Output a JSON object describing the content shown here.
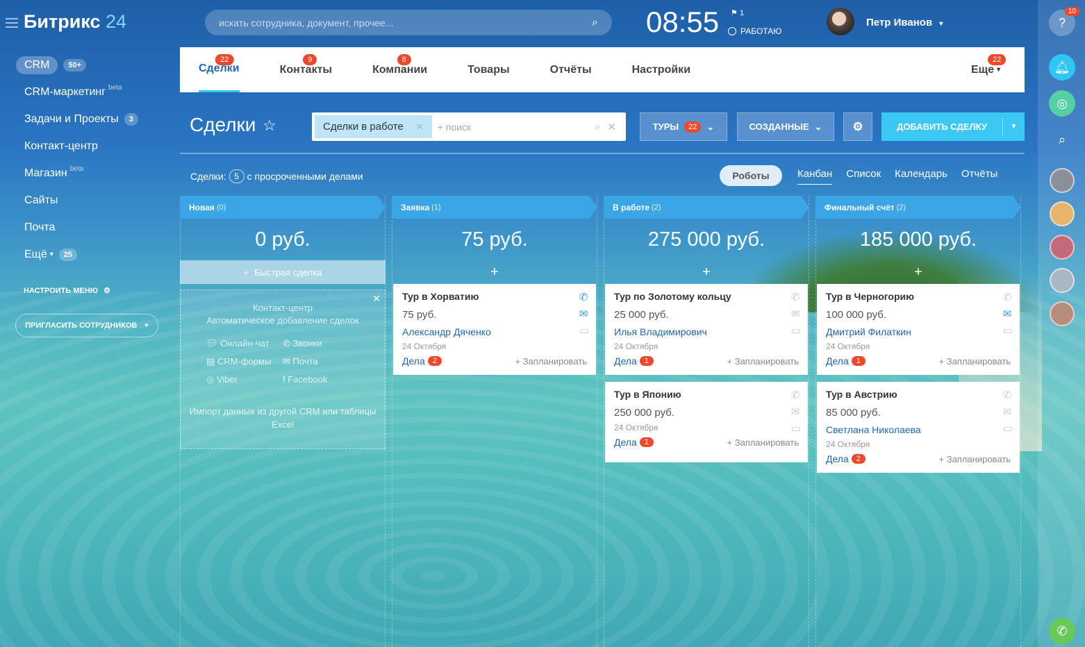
{
  "app": {
    "brand": "Битрикс",
    "brand_num": "24"
  },
  "search": {
    "placeholder": "искать сотрудника, документ, прочее..."
  },
  "clock": {
    "time": "08:55",
    "flag": "1",
    "status": "РАБОТАЮ"
  },
  "user": {
    "name": "Петр Иванов"
  },
  "sidebar": {
    "items": [
      {
        "label": "CRM",
        "count": "50+",
        "active": true
      },
      {
        "label": "CRM-маркетинг",
        "beta": "beta"
      },
      {
        "label": "Задачи и Проекты",
        "count": "3"
      },
      {
        "label": "Контакт-центр"
      },
      {
        "label": "Магазин",
        "beta": "beta"
      },
      {
        "label": "Сайты"
      },
      {
        "label": "Почта"
      },
      {
        "label": "Ещё",
        "count": "25"
      }
    ],
    "configure": "НАСТРОИТЬ МЕНЮ",
    "invite": "ПРИГЛАСИТЬ СОТРУДНИКОВ"
  },
  "tabs": [
    {
      "label": "Сделки",
      "badge": "22"
    },
    {
      "label": "Контакты",
      "badge": "9"
    },
    {
      "label": "Компании",
      "badge": "8"
    },
    {
      "label": "Товары",
      "badge": ""
    },
    {
      "label": "Отчёты",
      "badge": ""
    },
    {
      "label": "Настройки",
      "badge": ""
    }
  ],
  "more": {
    "label": "Еще",
    "badge": "22"
  },
  "page": {
    "title": "Сделки",
    "filter_chip": "Сделки в работе",
    "filter_placeholder": "+ поиск",
    "btn_tours": "ТУРЫ",
    "btn_tours_badge": "22",
    "btn_created": "СОЗДАННЫЕ",
    "btn_add": "ДОБАВИТЬ СДЕЛКУ",
    "overdue_prefix": "Сделки:",
    "overdue_count": "5",
    "overdue_suffix": "с просроченными делами",
    "robots": "Роботы",
    "views": [
      "Канбан",
      "Список",
      "Календарь",
      "Отчёты"
    ]
  },
  "columns": [
    {
      "name": "Новая",
      "count": "(0)",
      "sum": "0 руб.",
      "color": "#3aa6e6"
    },
    {
      "name": "Заявка",
      "count": "(1)",
      "sum": "75 руб.",
      "color": "#3aa6e6"
    },
    {
      "name": "В работе",
      "count": "(2)",
      "sum": "275 000 руб.",
      "color": "#3aa6e6"
    },
    {
      "name": "Финальный счёт",
      "count": "(2)",
      "sum": "185 000 руб.",
      "color": "#3aa6e6"
    }
  ],
  "quick_deal": "Быстрая сделка",
  "contact_center": {
    "title": "Контакт-центр",
    "subtitle": "Автоматическое добавление сделок",
    "items": [
      "Онлайн-чат",
      "Звонки",
      "CRM-формы",
      "Почта",
      "Viber",
      "Facebook"
    ],
    "import": "Импорт данных из другой CRM или таблицы Excel"
  },
  "cards": [
    {
      "title": "Тур в Хорватию",
      "price": "75 руб.",
      "person": "Александр Дяченко",
      "date": "24 Октября",
      "tasks": "Дела",
      "tasks_count": "2",
      "plan": "+ Запланировать"
    },
    {
      "title": "Тур по Золотому кольцу",
      "price": "25 000 руб.",
      "person": "Илья Владимирович",
      "date": "24 Октября",
      "tasks": "Дела",
      "tasks_count": "1",
      "plan": "+ Запланировать"
    },
    {
      "title": "Тур в Японию",
      "price": "250 000 руб.",
      "person": "",
      "date": "24 Октября",
      "tasks": "Дела",
      "tasks_count": "1",
      "plan": "+ Запланировать"
    },
    {
      "title": "Тур в Черногорию",
      "price": "100 000 руб.",
      "person": "Дмитрий Филаткин",
      "date": "24 Октября",
      "tasks": "Дела",
      "tasks_count": "1",
      "plan": "+ Запланировать"
    },
    {
      "title": "Тур в Австрию",
      "price": "85 000 руб.",
      "person": "Светлана Николаева",
      "date": "24 Октября",
      "tasks": "Дела",
      "tasks_count": "2",
      "plan": "+ Запланировать"
    }
  ],
  "right": {
    "help_badge": "10"
  },
  "colors": {
    "accent": "#3bc8f5",
    "badge": "#f0482c",
    "link": "#2067b0",
    "column": "#3aa6e6"
  }
}
